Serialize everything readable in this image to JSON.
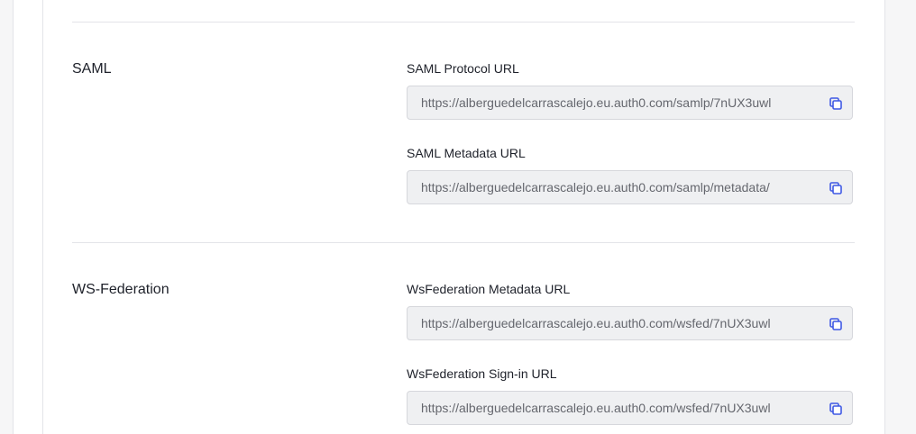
{
  "sections": [
    {
      "title": "SAML",
      "fields": [
        {
          "label": "SAML Protocol URL",
          "value": "https://alberguedelcarrascalejo.eu.auth0.com/samlp/7nUX3uwl"
        },
        {
          "label": "SAML Metadata URL",
          "value": "https://alberguedelcarrascalejo.eu.auth0.com/samlp/metadata/"
        }
      ]
    },
    {
      "title": "WS-Federation",
      "fields": [
        {
          "label": "WsFederation Metadata URL",
          "value": "https://alberguedelcarrascalejo.eu.auth0.com/wsfed/7nUX3uwl"
        },
        {
          "label": "WsFederation Sign-in URL",
          "value": "https://alberguedelcarrascalejo.eu.auth0.com/wsfed/7nUX3uwl"
        }
      ]
    }
  ],
  "icons": {
    "copy": "copy-icon"
  },
  "colors": {
    "accent": "#3f59e4",
    "field_bg": "#eff0f2",
    "field_text": "#65676e"
  }
}
